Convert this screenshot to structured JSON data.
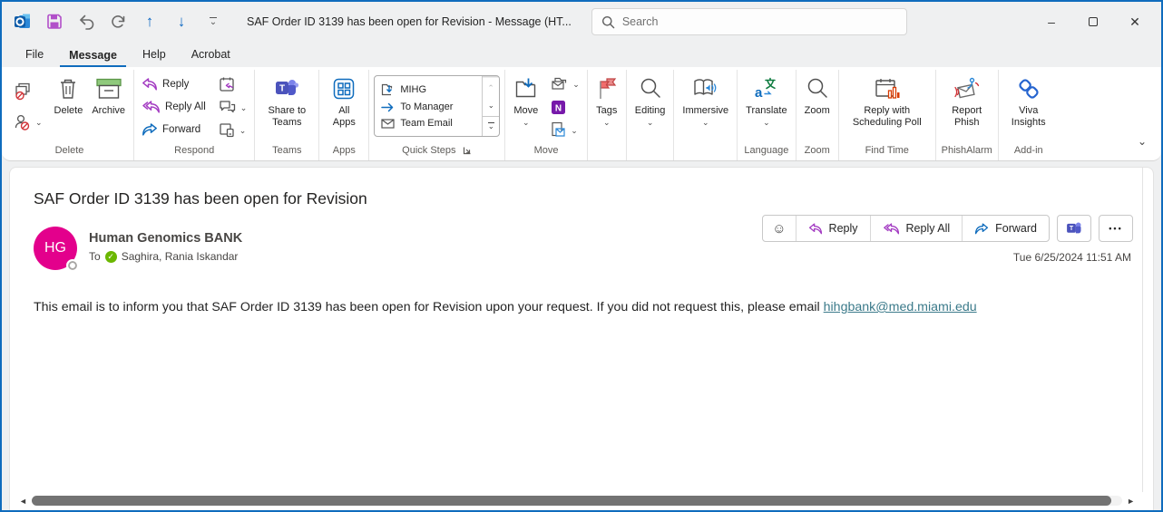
{
  "icons": {
    "chevron_down": "⌄",
    "up_arrow": "↑",
    "down_arrow": "↓",
    "minimize": "–",
    "close": "✕",
    "ellipsis": "•••",
    "emoji": "☺",
    "scroll_left": "◄",
    "scroll_right": "►",
    "check": "✓"
  },
  "titlebar": {
    "title": "SAF Order ID 3139 has been open for Revision  -  Message (HT...",
    "search_placeholder": "Search"
  },
  "menu": {
    "file": "File",
    "message": "Message",
    "help": "Help",
    "acrobat": "Acrobat"
  },
  "ribbon": {
    "delete": {
      "group": "Delete",
      "delete": "Delete",
      "archive": "Archive"
    },
    "respond": {
      "group": "Respond",
      "reply": "Reply",
      "reply_all": "Reply All",
      "forward": "Forward"
    },
    "teams": {
      "group": "Teams",
      "share": "Share to Teams"
    },
    "apps": {
      "group": "Apps",
      "all_apps": "All Apps"
    },
    "quick_steps": {
      "group": "Quick Steps",
      "items": [
        "MIHG",
        "To Manager",
        "Team Email"
      ]
    },
    "move": {
      "group": "Move",
      "move": "Move"
    },
    "tags": {
      "label": "Tags"
    },
    "editing": {
      "label": "Editing"
    },
    "immersive": {
      "label": "Immersive"
    },
    "language": {
      "group": "Language",
      "translate": "Translate"
    },
    "zoom": {
      "group": "Zoom",
      "zoom": "Zoom"
    },
    "find_time": {
      "group": "Find Time",
      "button": "Reply with Scheduling Poll"
    },
    "phishalarm": {
      "group": "PhishAlarm",
      "button": "Report Phish"
    },
    "addin": {
      "group": "Add-in",
      "button": "Viva Insights"
    }
  },
  "message": {
    "subject": "SAF Order ID 3139 has been open for Revision",
    "sender_initials": "HG",
    "sender_name": "Human Genomics BANK",
    "to_label": "To",
    "recipient": "Saghira, Rania Iskandar",
    "actions": {
      "reply": "Reply",
      "reply_all": "Reply All",
      "forward": "Forward"
    },
    "date": "Tue 6/25/2024 11:51 AM",
    "body": "This email is to inform you that SAF Order ID 3139 has been open for Revision upon your request. If you did not request this, please email ",
    "link": "hihgbank@med.miami.edu"
  },
  "colors": {
    "accent_blue": "#0f6cbd",
    "reply_purple": "#a33bc2",
    "avatar_pink": "#e3008c",
    "presence_green": "#6bb700",
    "link_teal": "#3b7a8a"
  }
}
